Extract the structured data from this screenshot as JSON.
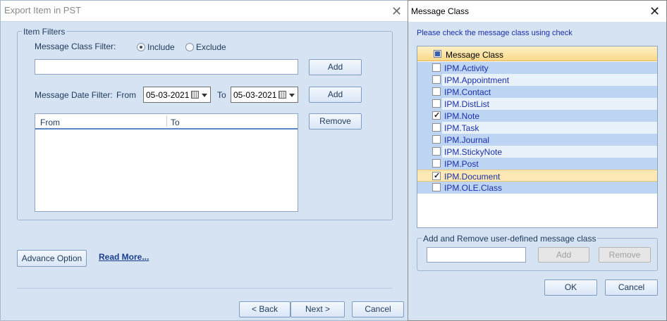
{
  "main_window": {
    "title": "Export Item in PST",
    "item_filters": {
      "group_label": "Item Filters",
      "message_class_label": "Message Class Filter:",
      "include_label": "Include",
      "exclude_label": "Exclude",
      "class_input_value": "",
      "add_label": "Add",
      "date_filter_label": "Message Date Filter:",
      "from_label": "From",
      "from_date": "05-03-2021",
      "to_label": "To",
      "to_date": "05-03-2021",
      "add_date_label": "Add",
      "remove_label": "Remove",
      "columns": [
        "From",
        "To"
      ]
    },
    "advance_option_label": "Advance Option",
    "read_more_label": "Read More...",
    "back_label": "< Back",
    "next_label": "Next >",
    "cancel_label": "Cancel"
  },
  "message_class_dialog": {
    "title": "Message Class",
    "instruction": "Please check the message class using check",
    "header_label": "Message Class",
    "items": [
      {
        "label": "IPM.Activity",
        "checked": false
      },
      {
        "label": "IPM.Appointment",
        "checked": false
      },
      {
        "label": "IPM.Contact",
        "checked": false
      },
      {
        "label": "IPM.DistList",
        "checked": false
      },
      {
        "label": "IPM.Note",
        "checked": true
      },
      {
        "label": "IPM.Task",
        "checked": false
      },
      {
        "label": "IPM.Journal",
        "checked": false
      },
      {
        "label": "IPM.StickyNote",
        "checked": false
      },
      {
        "label": "IPM.Post",
        "checked": false
      },
      {
        "label": "IPM.Document",
        "checked": true
      },
      {
        "label": "IPM.OLE.Class",
        "checked": false
      }
    ],
    "selected_index": 9,
    "user_defined_group_label": "Add and Remove user-defined message class",
    "user_input_value": "",
    "add_label": "Add",
    "remove_label": "Remove",
    "ok_label": "OK",
    "cancel_label": "Cancel"
  }
}
